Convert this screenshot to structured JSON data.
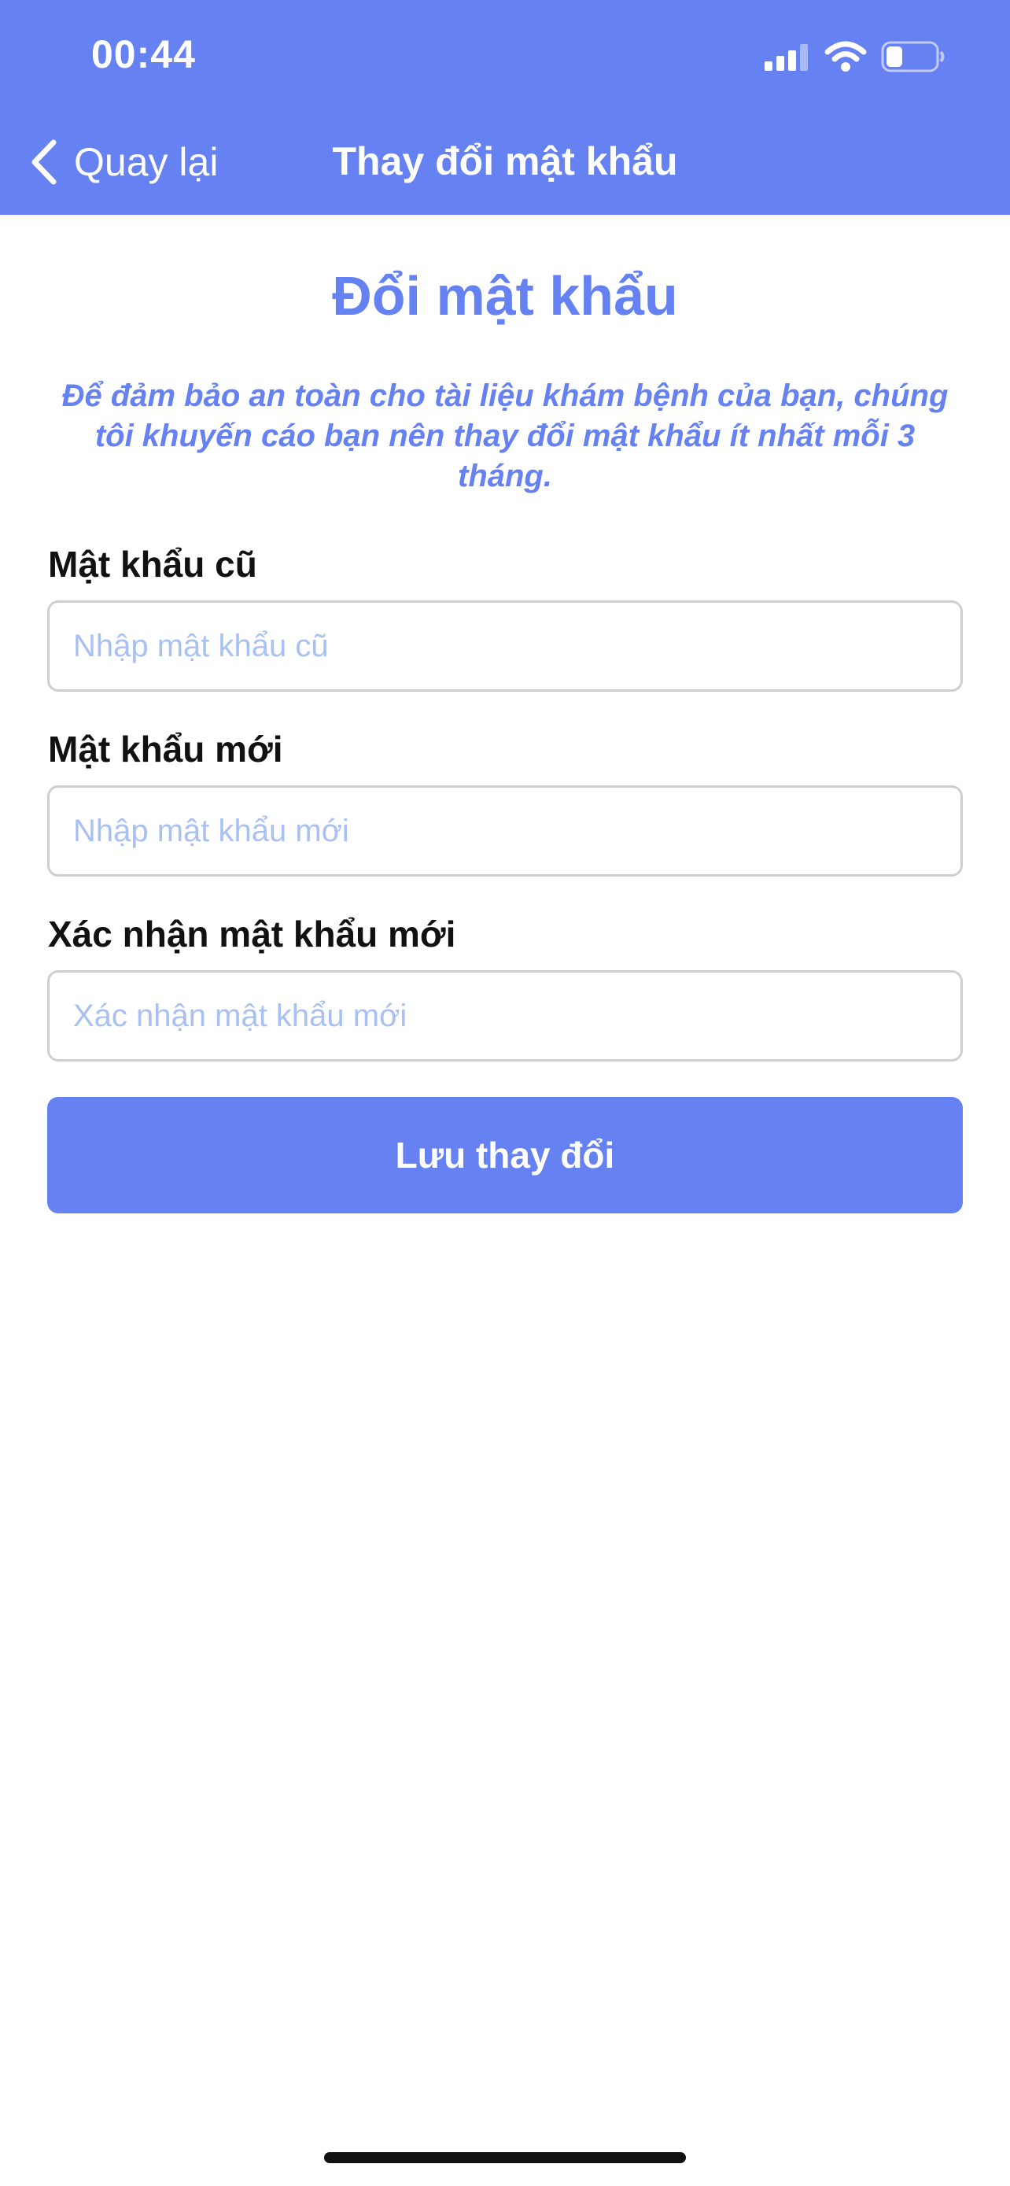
{
  "status_bar": {
    "time": "00:44",
    "icons": [
      "signal-icon",
      "wifi-icon",
      "battery-icon"
    ]
  },
  "nav": {
    "back_label": "Quay lại",
    "title": "Thay đổi mật khẩu",
    "back_icon": "chevron-left-icon"
  },
  "main": {
    "heading": "Đổi mật khẩu",
    "notice": "Để đảm bảo an toàn cho tài liệu khám bệnh của bạn, chúng tôi khuyến cáo bạn nên thay đổi mật khẩu ít nhất mỗi 3 tháng.",
    "fields": [
      {
        "label": "Mật khẩu cũ",
        "placeholder": "Nhập mật khẩu cũ",
        "value": ""
      },
      {
        "label": "Mật khẩu mới",
        "placeholder": "Nhập mật khẩu mới",
        "value": ""
      },
      {
        "label": "Xác nhận mật khẩu mới",
        "placeholder": "Xác nhận mật khẩu mới",
        "value": ""
      }
    ],
    "save_label": "Lưu thay đổi"
  },
  "colors": {
    "primary": "#6581F2",
    "placeholder": "#A9C0F2",
    "input_border": "#CFCFCF",
    "background": "#FFFFFF"
  }
}
